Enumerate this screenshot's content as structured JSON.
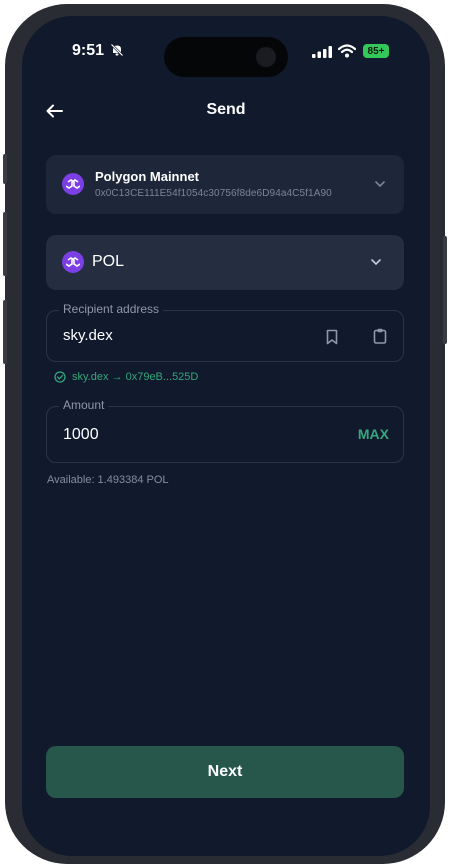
{
  "status_bar": {
    "time": "9:51",
    "battery": "85+"
  },
  "header": {
    "title": "Send"
  },
  "network": {
    "name": "Polygon Mainnet",
    "address": "0x0C13CE111E54f1054c30756f8de6D94a4C5f1A90"
  },
  "token": {
    "symbol": "POL"
  },
  "recipient": {
    "label": "Recipient address",
    "value": "sky.dex",
    "resolved": "sky.dex → 0x79eB...525D"
  },
  "amount": {
    "label": "Amount",
    "value": "1000",
    "max_label": "MAX",
    "available": "Available: 1.493384 POL"
  },
  "actions": {
    "next_label": "Next"
  },
  "colors": {
    "background": "#111a2c",
    "accent": "#3aa57f",
    "button": "#26574a",
    "polygon": "#7b3fe4"
  },
  "icons": [
    "back-arrow-icon",
    "bell-muted-icon",
    "signal-icon",
    "wifi-icon",
    "battery-icon",
    "polygon-logo-icon",
    "chevron-down-icon",
    "bookmark-icon",
    "clipboard-icon",
    "check-circle-icon"
  ]
}
